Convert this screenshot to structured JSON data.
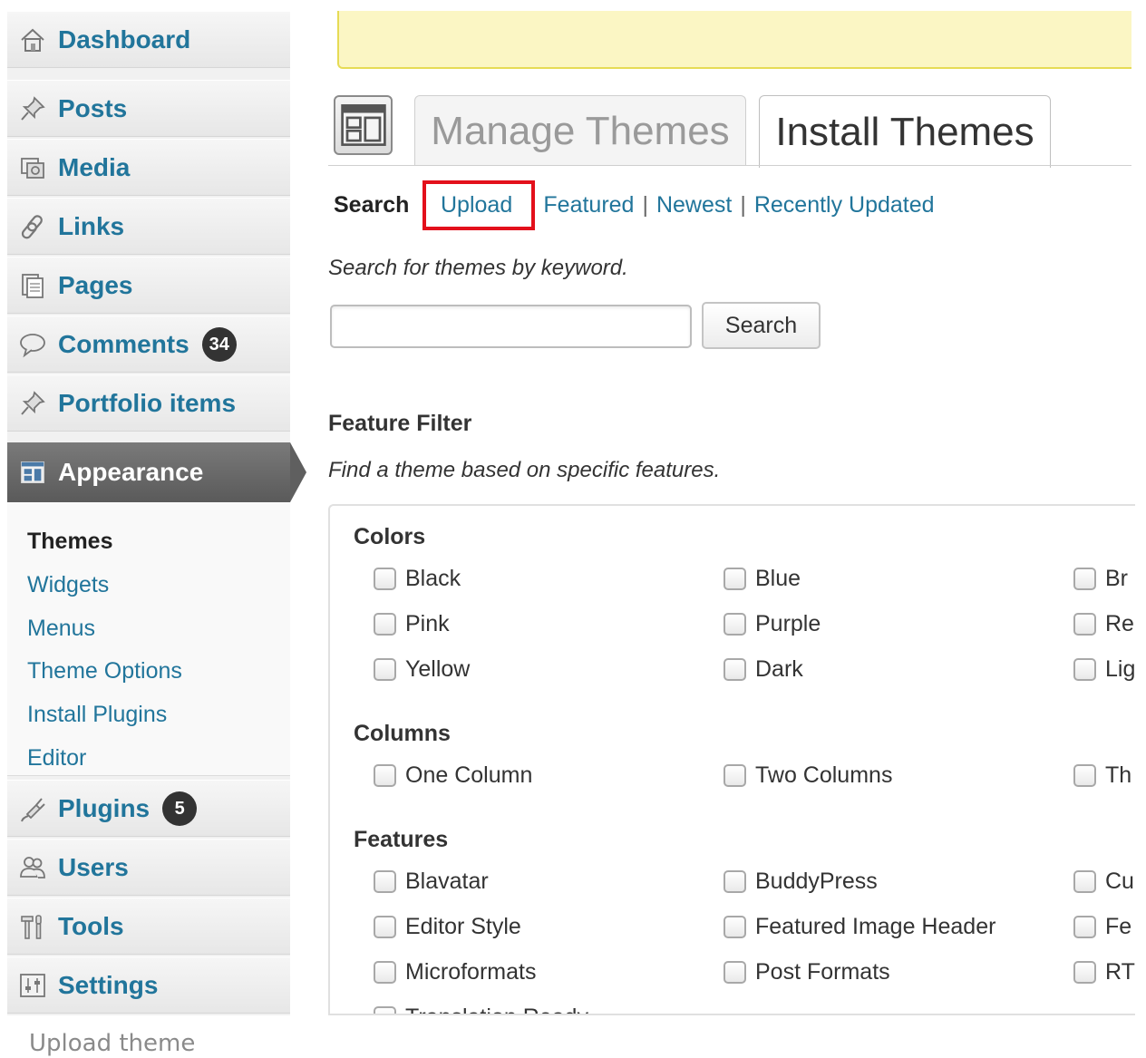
{
  "sidebar": {
    "dashboard": "Dashboard",
    "posts": "Posts",
    "media": "Media",
    "links": "Links",
    "pages": "Pages",
    "comments": "Comments",
    "comments_count": "34",
    "portfolio": "Portfolio items",
    "appearance": "Appearance",
    "submenu": {
      "themes": "Themes",
      "widgets": "Widgets",
      "menus": "Menus",
      "theme_options": "Theme Options",
      "install_plugins": "Install Plugins",
      "editor": "Editor"
    },
    "plugins": "Plugins",
    "plugins_count": "5",
    "users": "Users",
    "tools": "Tools",
    "settings": "Settings"
  },
  "tabs": {
    "manage": "Manage Themes",
    "install": "Install Themes"
  },
  "subnav": {
    "search": "Search",
    "upload": "Upload",
    "featured": "Featured",
    "newest": "Newest",
    "recently_updated": "Recently Updated",
    "separator": "|"
  },
  "search": {
    "description": "Search for themes by keyword.",
    "input_value": "",
    "button": "Search"
  },
  "feature_filter": {
    "title": "Feature Filter",
    "description": "Find a theme based on specific features.",
    "colors": {
      "title": "Colors",
      "items": [
        "Black",
        "Blue",
        "Br",
        "Pink",
        "Purple",
        "Re",
        "Yellow",
        "Dark",
        "Lig"
      ]
    },
    "columns": {
      "title": "Columns",
      "items": [
        "One Column",
        "Two Columns",
        "Th"
      ]
    },
    "features": {
      "title": "Features",
      "items": [
        "Blavatar",
        "BuddyPress",
        "Cu",
        "Editor Style",
        "Featured Image Header",
        "Fe",
        "Microformats",
        "Post Formats",
        "RT",
        "Translation Ready"
      ]
    }
  },
  "caption": "Upload theme",
  "colors": {
    "link": "#21759b",
    "highlight": "#e3101b",
    "notice_bg": "#fbf6c4",
    "appearance_bg": "#666666"
  }
}
